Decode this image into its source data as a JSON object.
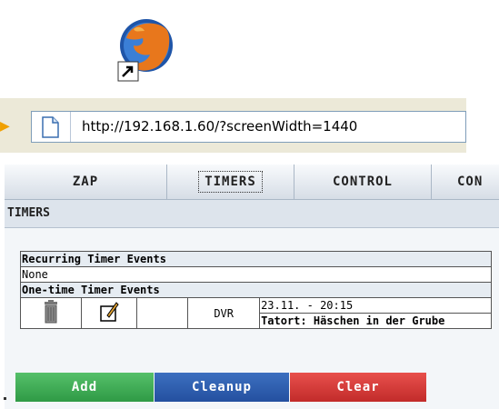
{
  "desktop": {
    "shortcut_icon": "firefox-shortcut-icon"
  },
  "browser": {
    "address_url": "http://192.168.1.60/?screenWidth=1440",
    "page_icon": "page-icon"
  },
  "tabs": [
    {
      "label": "ZAP",
      "active": false
    },
    {
      "label": "TIMERS",
      "active": true
    },
    {
      "label": "CONTROL",
      "active": false
    },
    {
      "label": "CON",
      "active": false
    }
  ],
  "section": {
    "title": "TIMERS"
  },
  "timers": {
    "recurring_header": "Recurring Timer Events",
    "recurring_none": "None",
    "onetime_header": "One-time Timer Events",
    "event": {
      "delete_icon": "trash-icon",
      "edit_icon": "edit-icon",
      "type": "DVR",
      "datetime": "23.11. - 20:15",
      "title": "Tatort: Häschen in der Grube"
    }
  },
  "buttons": {
    "add": "Add",
    "cleanup": "Cleanup",
    "clear": "Clear"
  },
  "colors": {
    "add": "#3aa84f",
    "cleanup": "#2d5bab",
    "clear": "#d63a37"
  }
}
